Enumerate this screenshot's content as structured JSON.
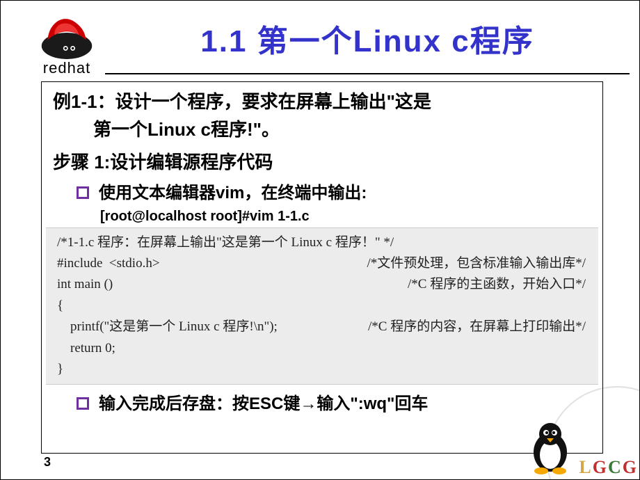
{
  "logo": {
    "text": "redhat"
  },
  "title": "1.1 第一个Linux c程序",
  "example": {
    "line1": "例1-1：设计一个程序，要求在屏幕上输出\"这是",
    "line2": "第一个Linux c程序!\"。"
  },
  "step1": "步骤 1:设计编辑源程序代码",
  "bullet1": "使用文本编辑器vim，在终端中输出:",
  "cmd": "[root@localhost root]#vim 1-1.c",
  "code": {
    "l1": "/*1-1.c 程序：在屏幕上输出\"这是第一个 Linux c 程序！\" */",
    "l2_left": "#include  <stdio.h>",
    "l2_right": "/*文件预处理，包含标准输入输出库*/",
    "l3_left": "int main ()",
    "l3_right": "/*C 程序的主函数，开始入口*/",
    "l4": "{",
    "l5_left": "    printf(\"这是第一个 Linux c 程序!\\n\");",
    "l5_right": "/*C 程序的内容，在屏幕上打印输出*/",
    "l6": "    return 0;",
    "l7": "}"
  },
  "bullet2": "输入完成后存盘：按ESC键→输入\":wq\"回车",
  "pageNumber": "3",
  "corner": {
    "text": "LGCG"
  }
}
